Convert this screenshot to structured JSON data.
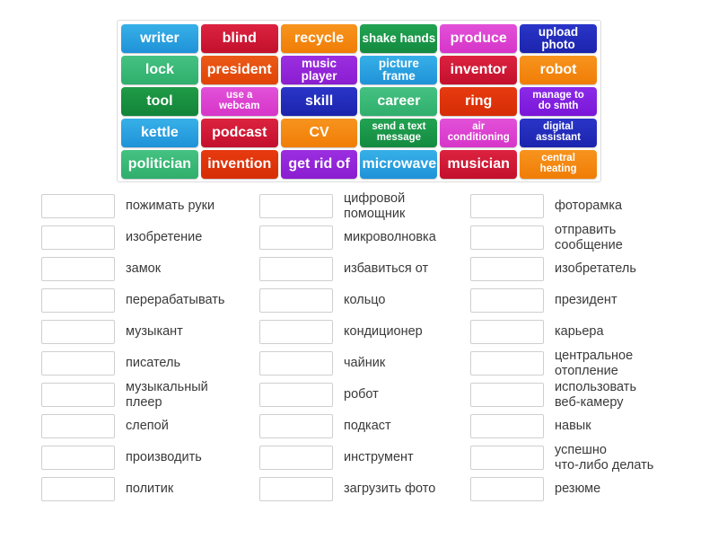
{
  "board": {
    "name": "word-tile-board",
    "rows": [
      [
        {
          "label": "writer",
          "color": "#37b0e8",
          "style": "c-lightblue",
          "size": "s-lg"
        },
        {
          "label": "blind",
          "color": "#dc2340",
          "style": "c-crimson",
          "size": "s-lg"
        },
        {
          "label": "recycle",
          "color": "#f7941e",
          "style": "c-orange",
          "size": "s-lg"
        },
        {
          "label": "shake hands",
          "color": "#22a352",
          "style": "c-green",
          "size": "s-md"
        },
        {
          "label": "produce",
          "color": "#e251d8",
          "style": "c-magenta",
          "size": "s-lg"
        },
        {
          "label": "upload photo",
          "color": "#2a35c8",
          "style": "c-blue",
          "size": "s-md"
        }
      ],
      [
        {
          "label": "lock",
          "color": "#45c281",
          "style": "c-emerald",
          "size": "s-lg"
        },
        {
          "label": "president",
          "color": "#ec5a18",
          "style": "c-redorange",
          "size": "s-lg"
        },
        {
          "label": "music player",
          "color": "#9b2fe0",
          "style": "c-purple",
          "size": "s-md"
        },
        {
          "label": "picture frame",
          "color": "#37b0e8",
          "style": "c-lightblue",
          "size": "s-md"
        },
        {
          "label": "inventor",
          "color": "#dc2340",
          "style": "c-crimson",
          "size": "s-lg"
        },
        {
          "label": "robot",
          "color": "#f7941e",
          "style": "c-orange",
          "size": "s-lg"
        }
      ],
      [
        {
          "label": "tool",
          "color": "#1f9b46",
          "style": "c-darkgreen",
          "size": "s-lg"
        },
        {
          "label": "use a\nwebcam",
          "color": "#e251d8",
          "style": "c-magenta",
          "size": "s-sm"
        },
        {
          "label": "skill",
          "color": "#2a35c8",
          "style": "c-blue",
          "size": "s-lg"
        },
        {
          "label": "career",
          "color": "#45c281",
          "style": "c-emerald",
          "size": "s-lg"
        },
        {
          "label": "ring",
          "color": "#e73a10",
          "style": "c-scarlet",
          "size": "s-lg"
        },
        {
          "label": "manage to\ndo smth",
          "color": "#8b2ae8",
          "style": "c-violet",
          "size": "s-sm"
        }
      ],
      [
        {
          "label": "kettle",
          "color": "#37b0e8",
          "style": "c-lightblue",
          "size": "s-lg"
        },
        {
          "label": "podcast",
          "color": "#dc2340",
          "style": "c-crimson",
          "size": "s-lg"
        },
        {
          "label": "CV",
          "color": "#f7941e",
          "style": "c-orange",
          "size": "s-lg"
        },
        {
          "label": "send a text\nmessage",
          "color": "#22a352",
          "style": "c-green",
          "size": "s-sm"
        },
        {
          "label": "air\nconditioning",
          "color": "#e251d8",
          "style": "c-magenta",
          "size": "s-sm"
        },
        {
          "label": "digital\nassistant",
          "color": "#2a35c8",
          "style": "c-blue",
          "size": "s-sm"
        }
      ],
      [
        {
          "label": "politician",
          "color": "#45c281",
          "style": "c-emerald",
          "size": "s-lg"
        },
        {
          "label": "invention",
          "color": "#e73a10",
          "style": "c-scarlet",
          "size": "s-lg"
        },
        {
          "label": "get rid of",
          "color": "#9b2fe0",
          "style": "c-purple",
          "size": "s-lg"
        },
        {
          "label": "microwave",
          "color": "#37b0e8",
          "style": "c-lightblue",
          "size": "s-lg"
        },
        {
          "label": "musician",
          "color": "#dc2340",
          "style": "c-crimson",
          "size": "s-lg"
        },
        {
          "label": "central\nheating",
          "color": "#f7941e",
          "style": "c-orange",
          "size": "s-sm"
        }
      ]
    ]
  },
  "answers": {
    "columns": [
      {
        "name": "answer-column-1",
        "items": [
          {
            "label": "пожимать руки"
          },
          {
            "label": "изобретение"
          },
          {
            "label": "замок"
          },
          {
            "label": "перерабатывать"
          },
          {
            "label": "музыкант"
          },
          {
            "label": "писатель"
          },
          {
            "label": "музыкальный\nплеер"
          },
          {
            "label": "слепой"
          },
          {
            "label": "производить"
          },
          {
            "label": "политик"
          }
        ]
      },
      {
        "name": "answer-column-2",
        "items": [
          {
            "label": "цифровой\nпомощник"
          },
          {
            "label": "микроволновка"
          },
          {
            "label": "избавиться от"
          },
          {
            "label": "кольцо"
          },
          {
            "label": "кондиционер"
          },
          {
            "label": "чайник"
          },
          {
            "label": "робот"
          },
          {
            "label": "подкаст"
          },
          {
            "label": "инструмент"
          },
          {
            "label": "загрузить фото"
          }
        ]
      },
      {
        "name": "answer-column-3",
        "items": [
          {
            "label": "фоторамка"
          },
          {
            "label": "отправить\nсообщение"
          },
          {
            "label": "изобретатель"
          },
          {
            "label": "президент"
          },
          {
            "label": "карьера"
          },
          {
            "label": "центральное\nотопление"
          },
          {
            "label": "использовать\nвеб-камеру"
          },
          {
            "label": "навык"
          },
          {
            "label": "успешно\nчто-либо делать"
          },
          {
            "label": "резюме"
          }
        ]
      }
    ]
  },
  "theme": {
    "page_background": "#ffffff",
    "board_border": "#dcdcdc",
    "box_border": "#cfcfcf",
    "label_color": "#3a3a3a",
    "tile_text_color": "#ffffff"
  }
}
